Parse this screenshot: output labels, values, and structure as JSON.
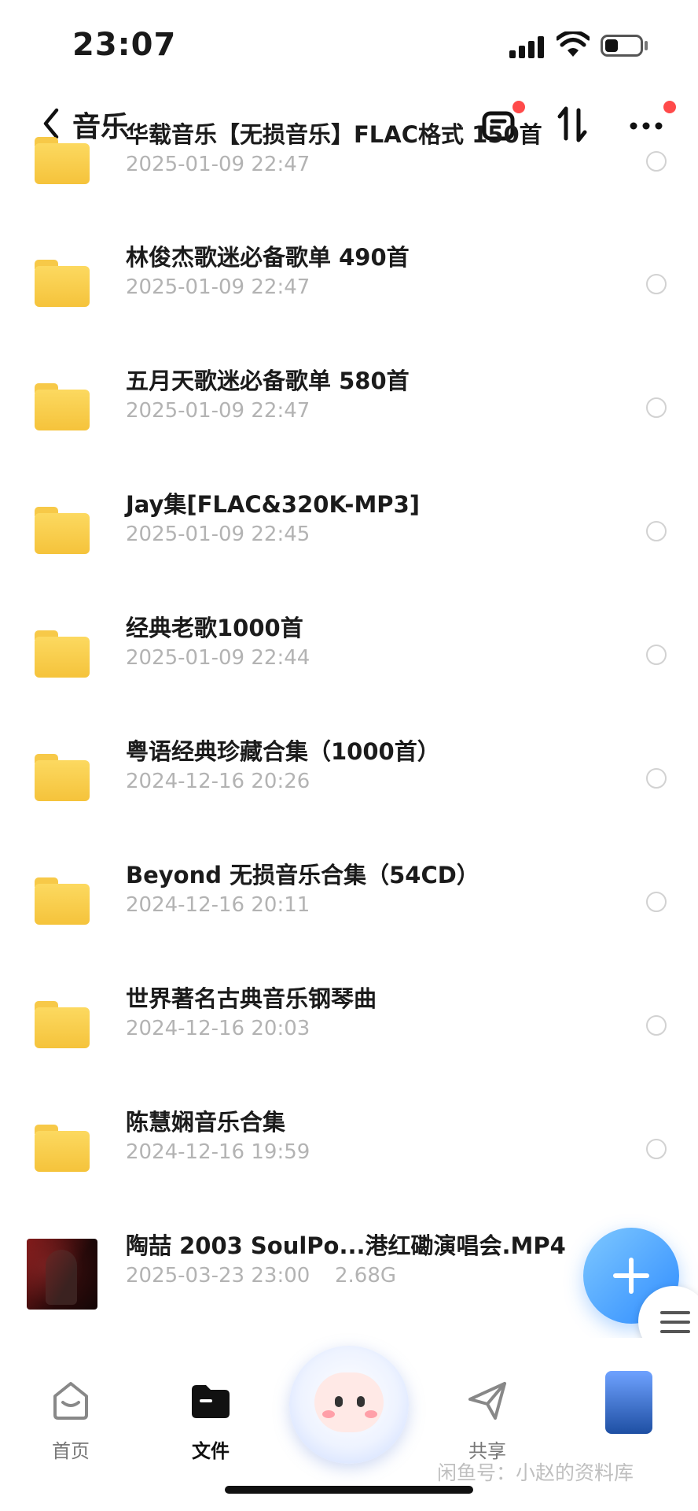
{
  "status_bar": {
    "time": "23:07"
  },
  "header": {
    "title": "音乐"
  },
  "files": [
    {
      "name": "华载音乐【无损音乐】FLAC格式 150首",
      "date": "2025-01-09 22:47",
      "type": "folder"
    },
    {
      "name": "林俊杰歌迷必备歌单 490首",
      "date": "2025-01-09 22:47",
      "type": "folder"
    },
    {
      "name": "五月天歌迷必备歌单 580首",
      "date": "2025-01-09 22:47",
      "type": "folder"
    },
    {
      "name": "Jay集[FLAC&320K-MP3]",
      "date": "2025-01-09 22:45",
      "type": "folder"
    },
    {
      "name": "经典老歌1000首",
      "date": "2025-01-09 22:44",
      "type": "folder"
    },
    {
      "name": "粤语经典珍藏合集（1000首）",
      "date": "2024-12-16 20:26",
      "type": "folder"
    },
    {
      "name": "Beyond 无损音乐合集（54CD）",
      "date": "2024-12-16 20:11",
      "type": "folder"
    },
    {
      "name": "世界著名古典音乐钢琴曲",
      "date": "2024-12-16 20:03",
      "type": "folder"
    },
    {
      "name": "陈慧娴音乐合集",
      "date": "2024-12-16 19:59",
      "type": "folder"
    },
    {
      "name": "陶喆 2003 SoulPo...港红磡演唱会.MP4",
      "date": "2025-03-23 23:00",
      "size": "2.68G",
      "type": "video"
    }
  ],
  "bottom_nav": {
    "home": "首页",
    "files": "文件",
    "share": "共享"
  },
  "watermark": "闲鱼号：小赵的资料库",
  "colors": {
    "accent": "#2f8cff",
    "folder": "#f7c948",
    "badge": "#ff4a4a"
  }
}
